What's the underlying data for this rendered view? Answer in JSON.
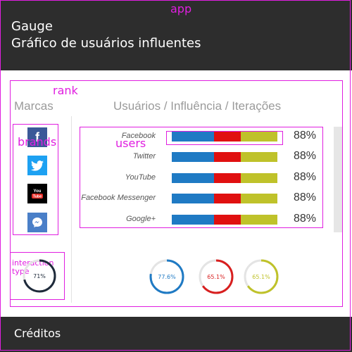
{
  "app_tag": "app",
  "header": {
    "title_line1": "Gauge",
    "title_line2": "Gráfico de usuários influentes"
  },
  "tags": {
    "rank": "rank",
    "brands": "brands",
    "users": "users",
    "interaction_type": "interaction type"
  },
  "columns": {
    "brands": "Marcas",
    "users": "Usuários / Influência / Iterações"
  },
  "brands": [
    {
      "name": "Facebook",
      "icon": "facebook-icon",
      "color": "#3b5998"
    },
    {
      "name": "Twitter",
      "icon": "twitter-icon",
      "color": "#1da1f2"
    },
    {
      "name": "YouTube",
      "icon": "youtube-icon",
      "color": "#000000"
    },
    {
      "name": "Facebook Messenger",
      "icon": "messenger-icon",
      "color": "#4a7fc8"
    }
  ],
  "users": [
    {
      "name": "Facebook",
      "percent": "88%",
      "segments": [
        0.4,
        0.25,
        0.35
      ]
    },
    {
      "name": "Twitter",
      "percent": "88%",
      "segments": [
        0.4,
        0.25,
        0.35
      ]
    },
    {
      "name": "YouTube",
      "percent": "88%",
      "segments": [
        0.4,
        0.25,
        0.35
      ]
    },
    {
      "name": "Facebook Messenger",
      "percent": "88%",
      "segments": [
        0.4,
        0.25,
        0.35
      ]
    },
    {
      "name": "Google+",
      "percent": "88%",
      "segments": [
        0.4,
        0.25,
        0.35
      ]
    }
  ],
  "segment_colors": [
    "#1f7ac4",
    "#e01010",
    "#bfc22a"
  ],
  "interaction_gauge": {
    "label": "71%",
    "value": 71,
    "color": "#1e2a3a"
  },
  "gauges": [
    {
      "label": "77.6%",
      "value": 77.6,
      "color": "#1f7ac4"
    },
    {
      "label": "65.1%",
      "value": 65.1,
      "color": "#d81f1f"
    },
    {
      "label": "65.1%",
      "value": 65.1,
      "color": "#bfc22a"
    }
  ],
  "footer": {
    "credits": "Créditos"
  }
}
